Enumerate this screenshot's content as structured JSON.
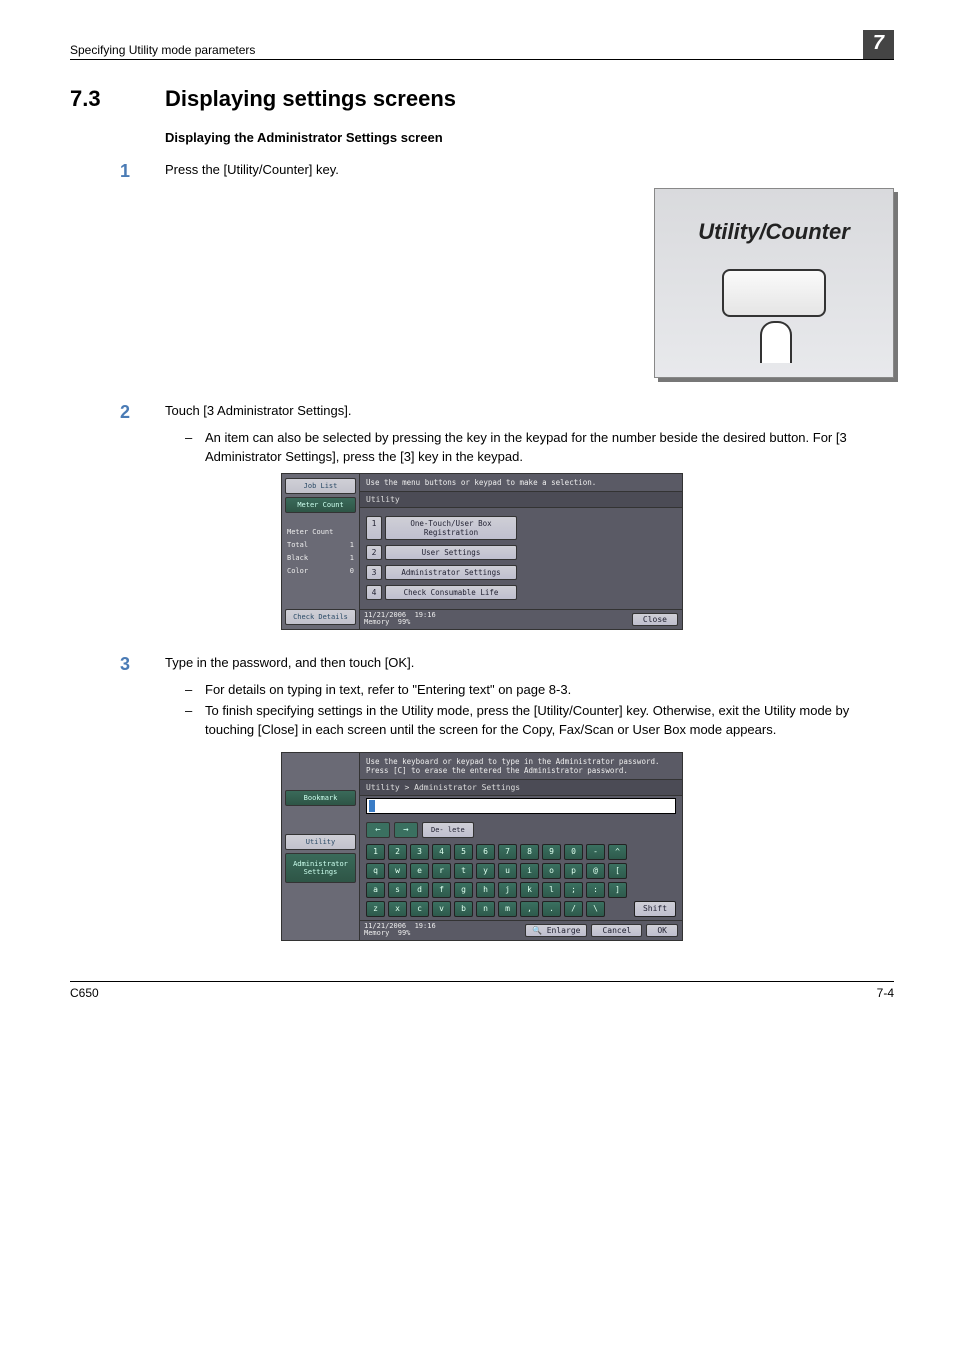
{
  "header": {
    "chapter": "Specifying Utility mode parameters",
    "chapter_num": "7"
  },
  "section": {
    "number": "7.3",
    "title": "Displaying settings screens",
    "subheading": "Displaying the Administrator Settings screen"
  },
  "step1": {
    "num": "1",
    "text": "Press the [Utility/Counter] key."
  },
  "uc_figure": {
    "label": "Utility/Counter"
  },
  "step2": {
    "num": "2",
    "text": "Touch [3 Administrator Settings].",
    "bullet1": "An item can also be selected by pressing the key in the keypad for the number beside the desired button. For [3 Administrator Settings], press the [3] key in the keypad."
  },
  "shot1": {
    "msg": "Use the menu buttons or keypad to make a selection.",
    "crumb": "Utility",
    "side": {
      "job_list": "Job List",
      "meter_count_btn": "Meter Count",
      "rows": [
        {
          "l": "Meter Count",
          "r": ""
        },
        {
          "l": "Total",
          "r": "1"
        },
        {
          "l": "Black",
          "r": "1"
        },
        {
          "l": "Color",
          "r": "0"
        }
      ],
      "check_details": "Check Details"
    },
    "menu": [
      {
        "n": "1",
        "l": "One-Touch/User Box Registration"
      },
      {
        "n": "2",
        "l": "User Settings"
      },
      {
        "n": "3",
        "l": "Administrator Settings"
      },
      {
        "n": "4",
        "l": "Check Consumable Life"
      }
    ],
    "footer": {
      "date": "11/21/2006",
      "time": "19:16",
      "mem_l": "Memory",
      "mem_v": "99%",
      "close": "Close"
    }
  },
  "step3": {
    "num": "3",
    "text": "Type in the password, and then touch [OK].",
    "bullet1": "For details on typing in text, refer to \"Entering text\" on page 8-3.",
    "bullet2": "To finish specifying settings in the Utility mode, press the [Utility/Counter] key. Otherwise, exit the Utility mode by touching [Close] in each screen until the screen for the Copy, Fax/Scan or User Box mode appears."
  },
  "shot2": {
    "msg1": "Use the keyboard or keypad to type in the Administrator password.",
    "msg2": "Press [C] to erase the entered the Administrator password.",
    "crumb": "Utility > Administrator Settings",
    "side": {
      "bookmark": "Bookmark",
      "utility": "Utility",
      "admin": "Administrator Settings"
    },
    "toolbar": {
      "delete": "De- lete"
    },
    "kbd": {
      "r1": [
        "1",
        "2",
        "3",
        "4",
        "5",
        "6",
        "7",
        "8",
        "9",
        "0",
        "-",
        "^"
      ],
      "r2": [
        "q",
        "w",
        "e",
        "r",
        "t",
        "y",
        "u",
        "i",
        "o",
        "p",
        "@",
        "["
      ],
      "r3": [
        "a",
        "s",
        "d",
        "f",
        "g",
        "h",
        "j",
        "k",
        "l",
        ";",
        ":",
        "]"
      ],
      "r4": [
        "z",
        "x",
        "c",
        "v",
        "b",
        "n",
        "m",
        ",",
        ".",
        "/",
        "\\"
      ],
      "shift": "Shift"
    },
    "footer": {
      "date": "11/21/2006",
      "time": "19:16",
      "mem_l": "Memory",
      "mem_v": "99%",
      "enlarge": "Enlarge",
      "cancel": "Cancel",
      "ok": "OK"
    }
  },
  "footer": {
    "model": "C650",
    "page": "7-4"
  }
}
